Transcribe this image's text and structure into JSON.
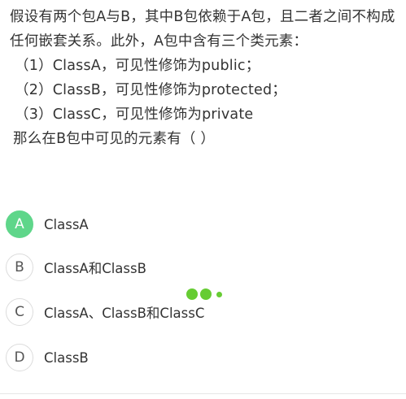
{
  "question": {
    "stem": "假设有两个包A与B，其中B包依赖于A包，且二者之间不构成任何嵌套关系。此外，A包中含有三个类元素：",
    "items": [
      "（1）ClassA，可见性修饰为public；",
      "（2）ClassB，可见性修饰为protected；",
      "（3）ClassC，可见性修饰为private"
    ],
    "ask": "那么在B包中可见的元素有（ ）"
  },
  "options": [
    {
      "letter": "A",
      "text": "ClassA",
      "selected": true
    },
    {
      "letter": "B",
      "text": "ClassA和ClassB",
      "selected": false
    },
    {
      "letter": "C",
      "text": "ClassA、ClassB和ClassC",
      "selected": false
    },
    {
      "letter": "D",
      "text": "ClassB",
      "selected": false
    }
  ],
  "colors": {
    "selected": "#5fd68a",
    "loading": "#66cc33",
    "text": "#333333"
  }
}
